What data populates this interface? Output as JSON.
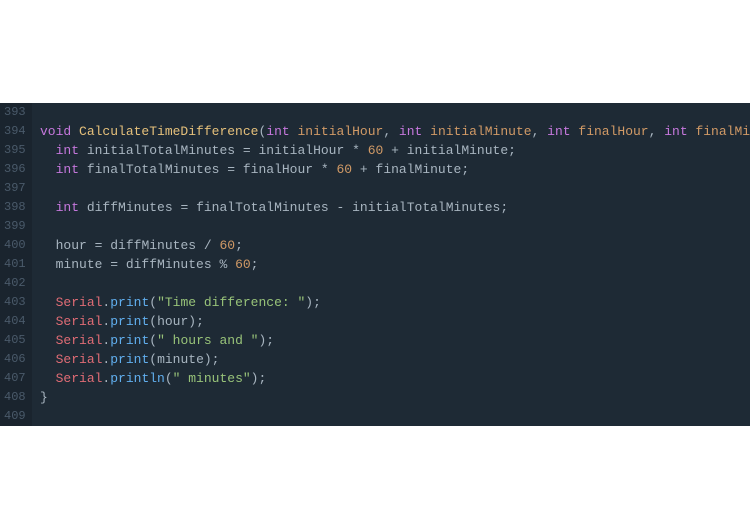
{
  "lines": [
    {
      "num": "393",
      "tokens": []
    },
    {
      "num": "394",
      "tokens": [
        {
          "cls": "type",
          "t": "void "
        },
        {
          "cls": "fn",
          "t": "CalculateTimeDifference"
        },
        {
          "cls": "punct",
          "t": "("
        },
        {
          "cls": "type",
          "t": "int "
        },
        {
          "cls": "param",
          "t": "initialHour"
        },
        {
          "cls": "punct",
          "t": ", "
        },
        {
          "cls": "type",
          "t": "int "
        },
        {
          "cls": "param",
          "t": "initialMinute"
        },
        {
          "cls": "punct",
          "t": ", "
        },
        {
          "cls": "type",
          "t": "int "
        },
        {
          "cls": "param",
          "t": "finalHour"
        },
        {
          "cls": "punct",
          "t": ", "
        },
        {
          "cls": "type",
          "t": "int "
        },
        {
          "cls": "param",
          "t": "finalMinute"
        },
        {
          "cls": "punct",
          "t": ") {"
        }
      ]
    },
    {
      "num": "395",
      "tokens": [
        {
          "cls": "",
          "t": "  "
        },
        {
          "cls": "type",
          "t": "int "
        },
        {
          "cls": "var",
          "t": "initialTotalMinutes "
        },
        {
          "cls": "op",
          "t": "= "
        },
        {
          "cls": "var",
          "t": "initialHour "
        },
        {
          "cls": "op",
          "t": "* "
        },
        {
          "cls": "num",
          "t": "60 "
        },
        {
          "cls": "op",
          "t": "+ "
        },
        {
          "cls": "var",
          "t": "initialMinute"
        },
        {
          "cls": "punct",
          "t": ";"
        }
      ]
    },
    {
      "num": "396",
      "tokens": [
        {
          "cls": "",
          "t": "  "
        },
        {
          "cls": "type",
          "t": "int "
        },
        {
          "cls": "var",
          "t": "finalTotalMinutes "
        },
        {
          "cls": "op",
          "t": "= "
        },
        {
          "cls": "var",
          "t": "finalHour "
        },
        {
          "cls": "op",
          "t": "* "
        },
        {
          "cls": "num",
          "t": "60 "
        },
        {
          "cls": "op",
          "t": "+ "
        },
        {
          "cls": "var",
          "t": "finalMinute"
        },
        {
          "cls": "punct",
          "t": ";"
        }
      ]
    },
    {
      "num": "397",
      "tokens": []
    },
    {
      "num": "398",
      "tokens": [
        {
          "cls": "",
          "t": "  "
        },
        {
          "cls": "type",
          "t": "int "
        },
        {
          "cls": "var",
          "t": "diffMinutes "
        },
        {
          "cls": "op",
          "t": "= "
        },
        {
          "cls": "var",
          "t": "finalTotalMinutes "
        },
        {
          "cls": "op",
          "t": "- "
        },
        {
          "cls": "var",
          "t": "initialTotalMinutes"
        },
        {
          "cls": "punct",
          "t": ";"
        }
      ]
    },
    {
      "num": "399",
      "tokens": []
    },
    {
      "num": "400",
      "tokens": [
        {
          "cls": "",
          "t": "  "
        },
        {
          "cls": "var",
          "t": "hour "
        },
        {
          "cls": "op",
          "t": "= "
        },
        {
          "cls": "var",
          "t": "diffMinutes "
        },
        {
          "cls": "op",
          "t": "/ "
        },
        {
          "cls": "num",
          "t": "60"
        },
        {
          "cls": "punct",
          "t": ";"
        }
      ]
    },
    {
      "num": "401",
      "tokens": [
        {
          "cls": "",
          "t": "  "
        },
        {
          "cls": "var",
          "t": "minute "
        },
        {
          "cls": "op",
          "t": "= "
        },
        {
          "cls": "var",
          "t": "diffMinutes "
        },
        {
          "cls": "op",
          "t": "% "
        },
        {
          "cls": "num",
          "t": "60"
        },
        {
          "cls": "punct",
          "t": ";"
        }
      ]
    },
    {
      "num": "402",
      "tokens": []
    },
    {
      "num": "403",
      "tokens": [
        {
          "cls": "",
          "t": "  "
        },
        {
          "cls": "obj",
          "t": "Serial"
        },
        {
          "cls": "punct",
          "t": "."
        },
        {
          "cls": "method",
          "t": "print"
        },
        {
          "cls": "punct",
          "t": "("
        },
        {
          "cls": "str",
          "t": "\"Time difference: \""
        },
        {
          "cls": "punct",
          "t": ");"
        }
      ]
    },
    {
      "num": "404",
      "tokens": [
        {
          "cls": "",
          "t": "  "
        },
        {
          "cls": "obj",
          "t": "Serial"
        },
        {
          "cls": "punct",
          "t": "."
        },
        {
          "cls": "method",
          "t": "print"
        },
        {
          "cls": "punct",
          "t": "("
        },
        {
          "cls": "var",
          "t": "hour"
        },
        {
          "cls": "punct",
          "t": ");"
        }
      ]
    },
    {
      "num": "405",
      "tokens": [
        {
          "cls": "",
          "t": "  "
        },
        {
          "cls": "obj",
          "t": "Serial"
        },
        {
          "cls": "punct",
          "t": "."
        },
        {
          "cls": "method",
          "t": "print"
        },
        {
          "cls": "punct",
          "t": "("
        },
        {
          "cls": "str",
          "t": "\" hours and \""
        },
        {
          "cls": "punct",
          "t": ");"
        }
      ]
    },
    {
      "num": "406",
      "tokens": [
        {
          "cls": "",
          "t": "  "
        },
        {
          "cls": "obj",
          "t": "Serial"
        },
        {
          "cls": "punct",
          "t": "."
        },
        {
          "cls": "method",
          "t": "print"
        },
        {
          "cls": "punct",
          "t": "("
        },
        {
          "cls": "var",
          "t": "minute"
        },
        {
          "cls": "punct",
          "t": ");"
        }
      ]
    },
    {
      "num": "407",
      "tokens": [
        {
          "cls": "",
          "t": "  "
        },
        {
          "cls": "obj",
          "t": "Serial"
        },
        {
          "cls": "punct",
          "t": "."
        },
        {
          "cls": "method",
          "t": "println"
        },
        {
          "cls": "punct",
          "t": "("
        },
        {
          "cls": "str",
          "t": "\" minutes\""
        },
        {
          "cls": "punct",
          "t": ");"
        }
      ]
    },
    {
      "num": "408",
      "tokens": [
        {
          "cls": "punct",
          "t": "}"
        }
      ]
    },
    {
      "num": "409",
      "tokens": []
    }
  ]
}
